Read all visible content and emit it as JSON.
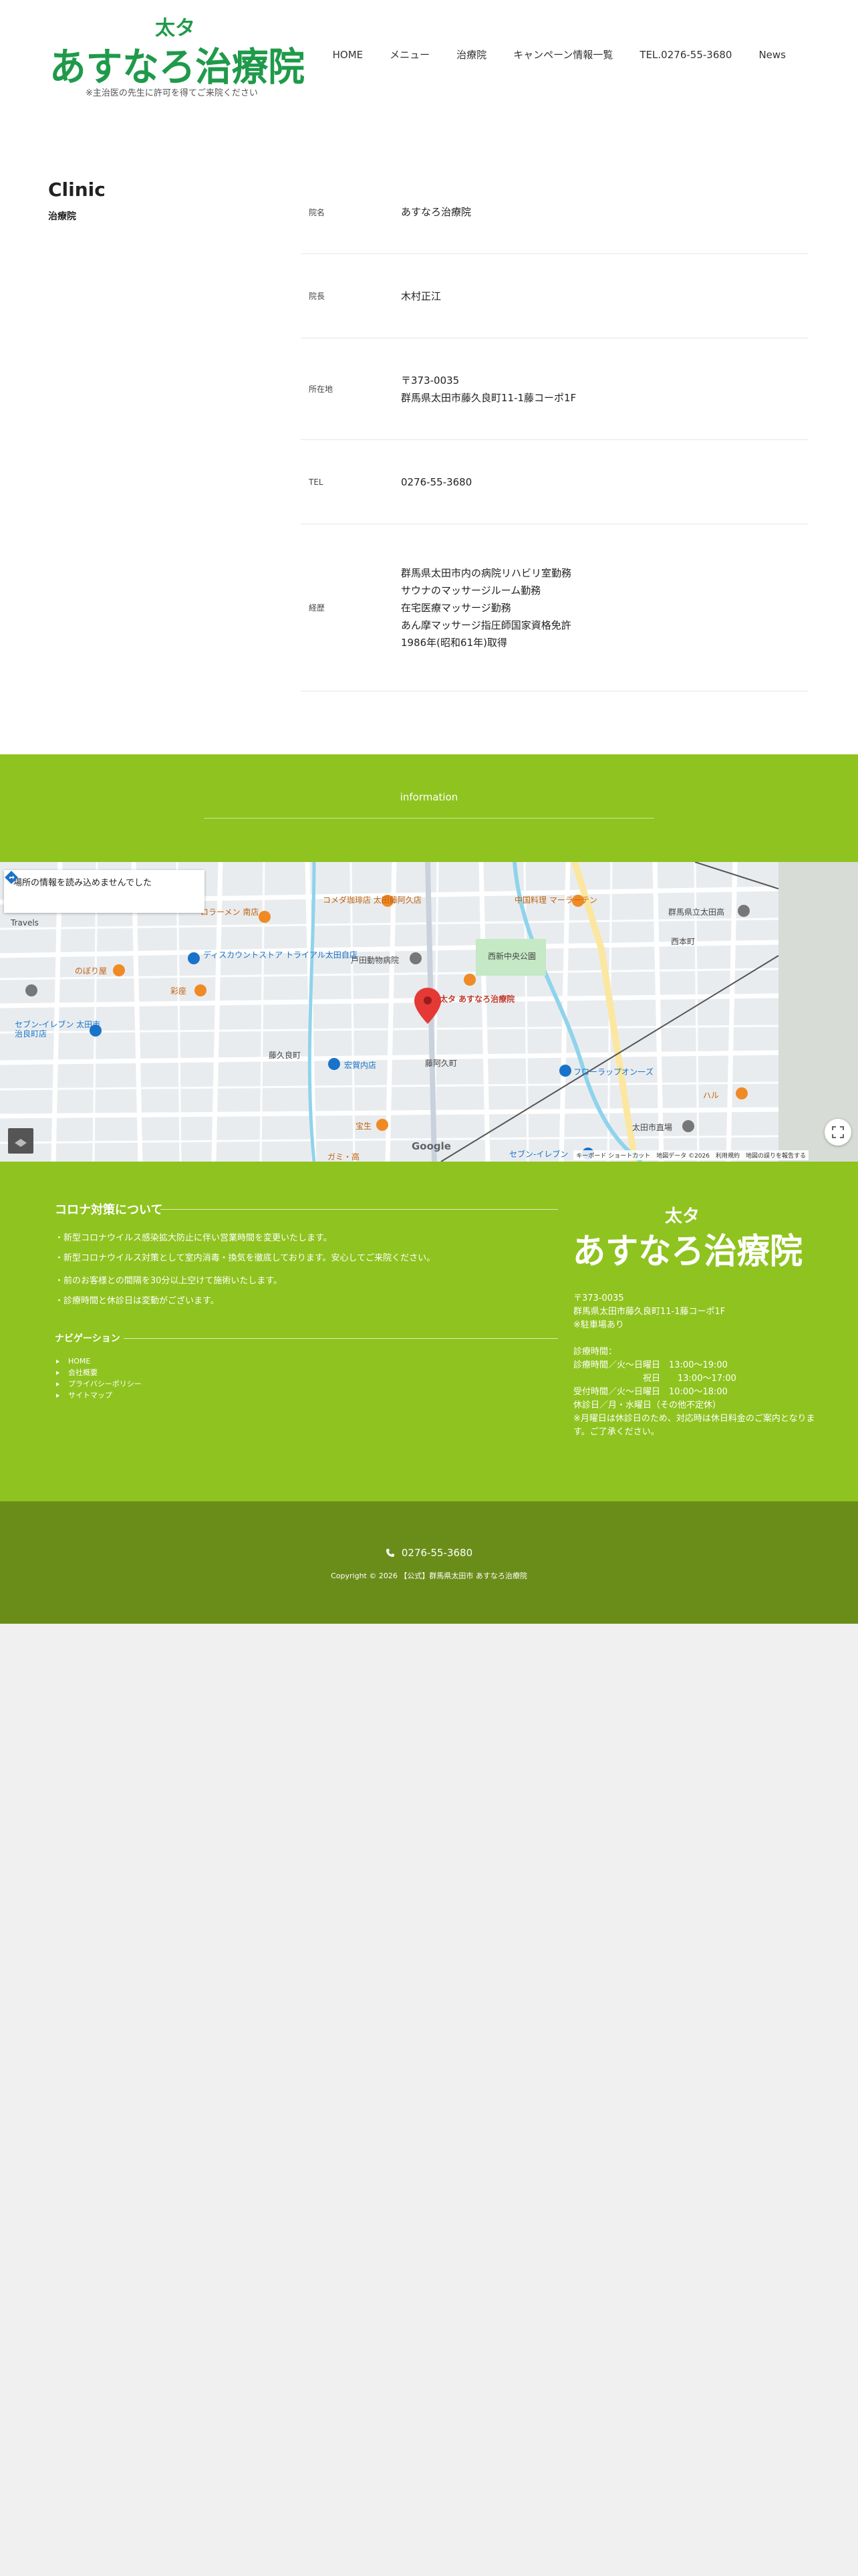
{
  "header": {
    "logo_small": "太タ",
    "logo_main": "あすなろ治療院",
    "logo_note": "※主治医の先生に許可を得てご来院ください",
    "nav": [
      "HOME",
      "メニュー",
      "治療院",
      "キャンペーン情報一覧",
      "TEL.0276-55-3680",
      "News"
    ]
  },
  "main": {
    "title": "Clinic",
    "subtitle": "治療院",
    "rows": [
      {
        "label": "院名",
        "lines": [
          "あすなろ治療院"
        ]
      },
      {
        "label": "院長",
        "lines": [
          "木村正江"
        ]
      },
      {
        "label": "所在地",
        "lines": [
          "〒373-0035",
          "群馬県太田市藤久良町11-1藤コーポ1F"
        ]
      },
      {
        "label": "TEL",
        "lines": [
          "0276-55-3680"
        ]
      },
      {
        "label": "経歴",
        "lines": [
          "群馬県太田市内の病院リハビリ室勤務",
          "サウナのマッサージルーム勤務",
          "在宅医療マッサージ勤務",
          "あん摩マッサージ指圧師国家資格免許",
          "1986年(昭和61年)取得"
        ]
      }
    ]
  },
  "information": {
    "title": "information"
  },
  "map": {
    "error_text": "場所の情報を読み込めませんでした",
    "labels": {
      "ramen": "ロラーメン 南店",
      "komeda": "コメダ珈琲店 太田藤阿久店",
      "chuka": "中国料理 マーラーテン",
      "gunma_dai": "群馬県立太田高",
      "nishihon": "西本町",
      "discount": "ディスカウントストア トライアル太田自店",
      "toda": "戸田動物病院",
      "park": "西新中央公園",
      "nobori": "のぼり屋",
      "hikoza": "彩座",
      "pin": "太タ あすなろ治療院",
      "seven1": "セブン-イレブン 太田市治良町店",
      "fujikyu": "藤久良町",
      "tetsukyo": "宏賀内店",
      "fujiaku": "藤阿久町",
      "flower": "フローラップオン一ズ",
      "ota_sta": "太田市直場",
      "hosen": "宝生",
      "sevenbottom": "セブン-イレブン",
      "haru": "ハル",
      "kaketaka": "ガミ・高",
      "travel": "Travels"
    },
    "footer": "キーボード ショートカット　地図データ ©2026　利用規約　地図の誤りを報告する",
    "google": "Google"
  },
  "footer": {
    "corona_title": "コロナ対策について",
    "corona_items": [
      "・新型コロナウイルス感染拡大防止に伴い営業時間を変更いたします。",
      "・新型コロナウイルス対策として室内消毒・換気を徹底しております。安心してご来院ください。",
      "・前のお客様との間隔を30分以上空けて施術いたします。",
      "・診療時間と休診日は変動がございます。"
    ],
    "navi_title": "ナビゲーション",
    "navi_items": [
      "HOME",
      "会社概要",
      "プライバシーポリシー",
      "サイトマップ"
    ],
    "logo_small": "太タ",
    "logo_main": "あすなろ治療院",
    "address_lines": [
      "〒373-0035",
      "群馬県太田市藤久良町11-1藤コーポ1F",
      "※駐車場あり",
      "",
      "診療時間：",
      "診療時間／火～日曜日　13:00～19:00",
      "　　　　　　　　祝日　　13:00～17:00",
      "受付時間／火～日曜日　10:00～18:00",
      "休診日／月・水曜日（その他不定休）",
      "※月曜日は休診日のため、対応時は休日料金のご案内となります。ご了承ください。"
    ]
  },
  "bottom": {
    "tel": "0276-55-3680",
    "copyright": "Copyright © 2026 【公式】群馬県太田市 あすなろ治療院"
  },
  "colors": {
    "brand_green": "#8fc31f",
    "dark_green": "#6a8d1a",
    "logo_green": "#1f9a4a"
  }
}
